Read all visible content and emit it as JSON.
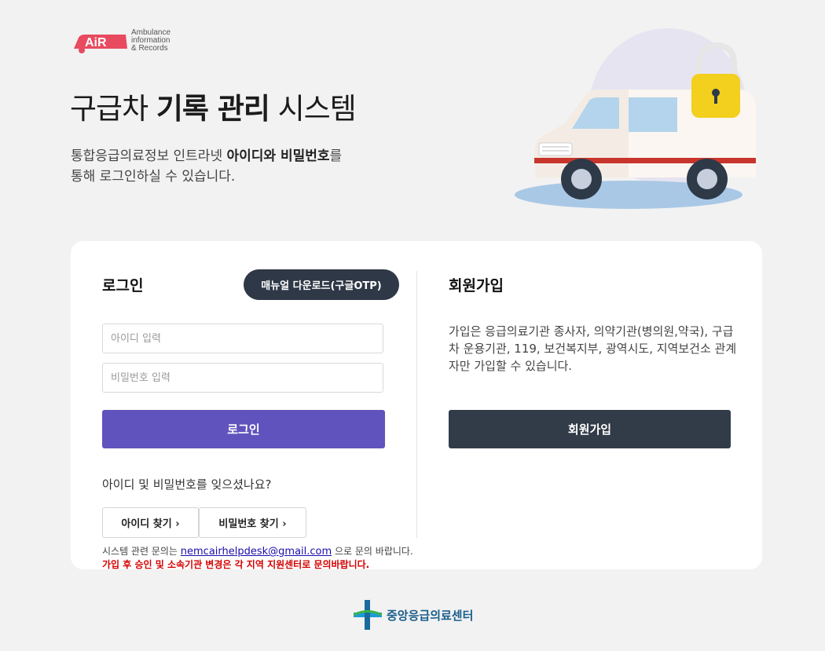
{
  "brand": {
    "logo_text": "AiR",
    "logo_line1": "Ambulance",
    "logo_line2": "information",
    "logo_line3": "& Records"
  },
  "header": {
    "title_part1": "구급차 ",
    "title_bold": "기록 관리",
    "title_part2": " 시스템",
    "desc_part1": "통합응급의료정보 인트라넷 ",
    "desc_bold": "아이디와 비밀번호",
    "desc_part2": "를",
    "desc_line2": "통해 로그인하실 수 있습니다."
  },
  "login": {
    "heading": "로그인",
    "manual_button": "매뉴얼 다운로드(구글OTP)",
    "id_placeholder": "아이디 입력",
    "id_value": "",
    "pw_placeholder": "비밀번호 입력",
    "pw_value": "",
    "submit_label": "로그인",
    "forgot_text": "아이디 및 비밀번호를 잊으셨나요?",
    "find_id_label": "아이디 찾기 ›",
    "find_pw_label": "비밀번호 찾기 ›",
    "contact_prefix": "시스템 관련 문의는 ",
    "contact_email": "nemcairhelpdesk@gmail.com",
    "contact_suffix": " 으로 문의 바랍니다.",
    "warning": "가입 후 승인 및 소속기관 변경은 각 지역 지원센터로 문의바랍니다."
  },
  "signup": {
    "heading": "회원가입",
    "description": "가입은 응급의료기관 종사자, 의약기관(병의원,약국), 구급차 운용기관, 119, 보건복지부, 광역시도, 지역보건소 관계자만 가입할 수 있습니다.",
    "button_label": "회원가입"
  },
  "footer": {
    "org_name": "중앙응급의료센터"
  },
  "colors": {
    "primary": "#6153bd",
    "dark": "#323b48",
    "warning": "#d40000",
    "brand_red": "#e84a5f"
  }
}
